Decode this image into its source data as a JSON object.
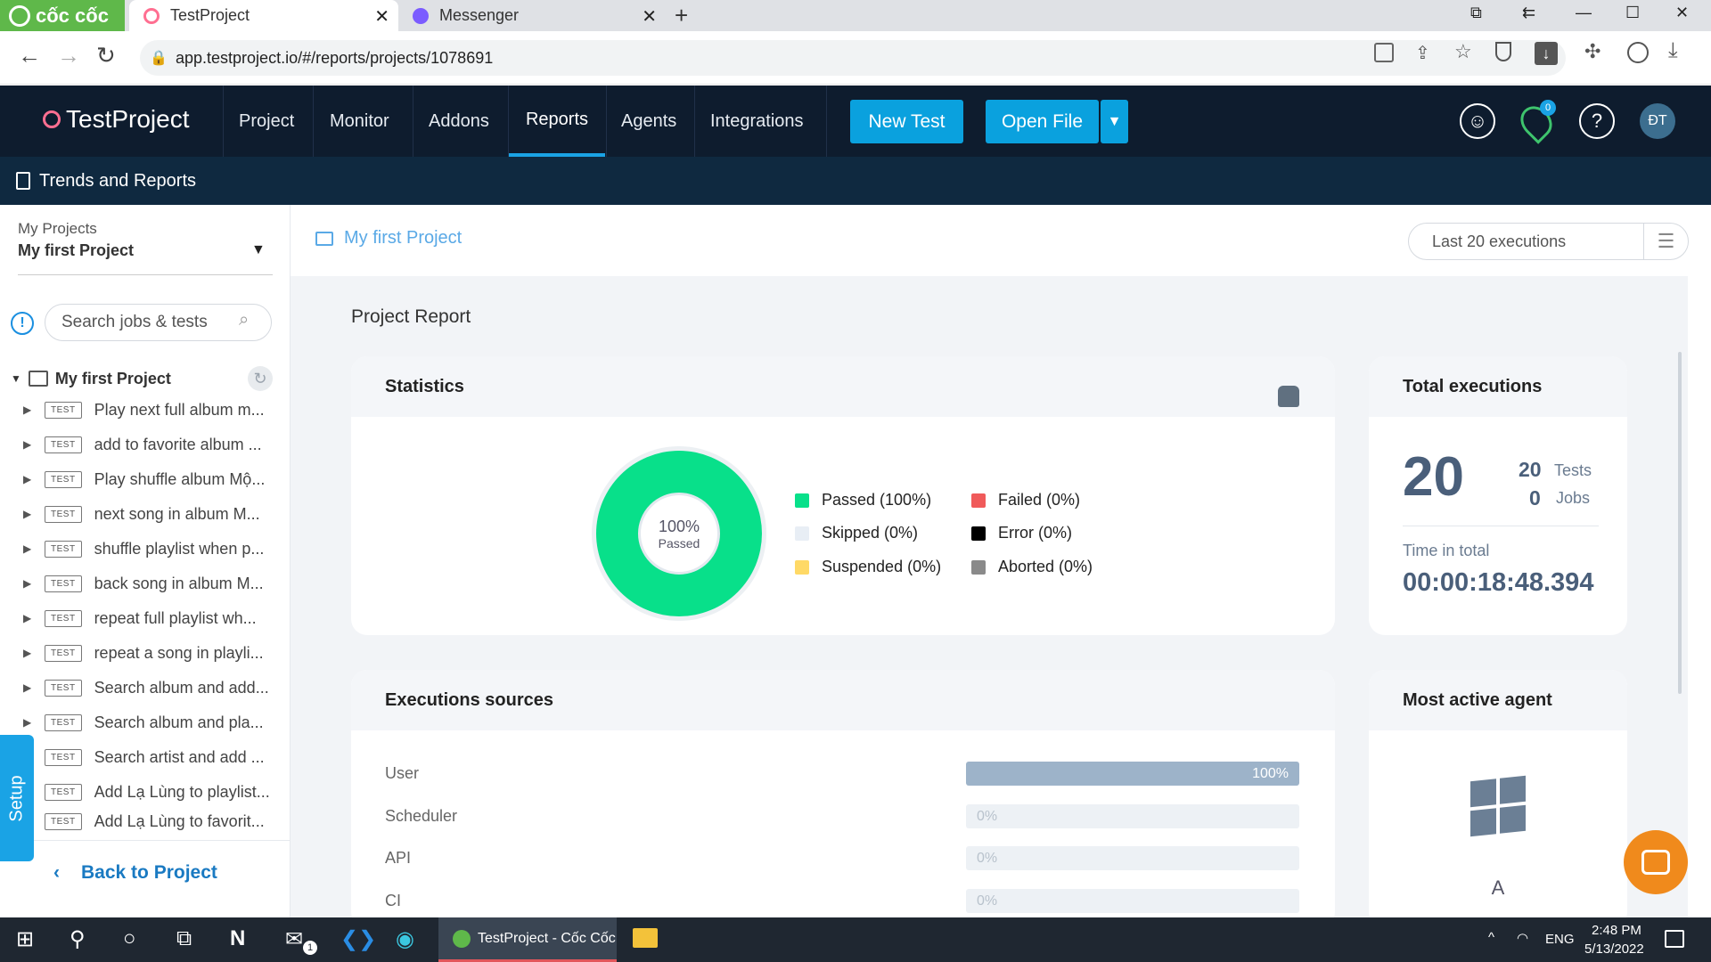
{
  "browser": {
    "brand": "cốc cốc",
    "tabs": [
      {
        "title": "TestProject",
        "active": true
      },
      {
        "title": "Messenger",
        "active": false
      }
    ],
    "url": "app.testproject.io/#/reports/projects/1078691"
  },
  "app": {
    "logo": "TestProject",
    "nav": [
      "Project",
      "Monitor",
      "Addons",
      "Reports",
      "Agents",
      "Integrations"
    ],
    "active_nav": "Reports",
    "new_test": "New Test",
    "open_file": "Open File",
    "notification_count": "0",
    "avatar": "ĐT",
    "subheader": "Trends and Reports"
  },
  "sidebar": {
    "projects_label": "My Projects",
    "project_name": "My first Project",
    "search_placeholder": "Search jobs & tests",
    "root": "My first Project",
    "test_tag": "TEST",
    "tests": [
      "Play next full album m...",
      "add to favorite album ...",
      "Play shuffle album Mộ...",
      "next song in album M...",
      "shuffle playlist when p...",
      "back song in album M...",
      "repeat full playlist wh...",
      "repeat a song in playli...",
      "Search album and add...",
      "Search album and pla...",
      "Search artist and add ...",
      "Add Lạ Lùng to playlist...",
      "Add Lạ Lùng to favorit..."
    ],
    "back": "Back to Project",
    "setup": "Setup"
  },
  "main": {
    "breadcrumb": "My first Project",
    "filter": "Last 20 executions",
    "title": "Project Report",
    "statistics": {
      "title": "Statistics",
      "center_pct": "100%",
      "center_label": "Passed",
      "legend": [
        {
          "label": "Passed (100%)",
          "color": "#08e08a"
        },
        {
          "label": "Skipped (0%)",
          "color": "#e8eef5"
        },
        {
          "label": "Suspended (0%)",
          "color": "#ffd966"
        },
        {
          "label": "Failed (0%)",
          "color": "#f05a5a"
        },
        {
          "label": "Error (0%)",
          "color": "#000000"
        },
        {
          "label": "Aborted (0%)",
          "color": "#8a8a8a"
        }
      ]
    },
    "total": {
      "title": "Total executions",
      "count": "20",
      "tests_count": "20",
      "tests_label": "Tests",
      "jobs_count": "0",
      "jobs_label": "Jobs",
      "time_label": "Time in total",
      "time_value": "00:00:18:48.394"
    },
    "sources": {
      "title": "Executions sources",
      "rows": [
        {
          "label": "User",
          "value": "100%",
          "fraction": 1.0
        },
        {
          "label": "Scheduler",
          "value": "0%",
          "fraction": 0
        },
        {
          "label": "API",
          "value": "0%",
          "fraction": 0
        },
        {
          "label": "CI",
          "value": "0%",
          "fraction": 0
        }
      ]
    },
    "agent": {
      "title": "Most active agent",
      "name": "A"
    }
  },
  "taskbar": {
    "app": "TestProject - Cốc Cốc",
    "lang": "ENG",
    "time": "2:48 PM",
    "date": "5/13/2022",
    "mail_badge": "1"
  }
}
